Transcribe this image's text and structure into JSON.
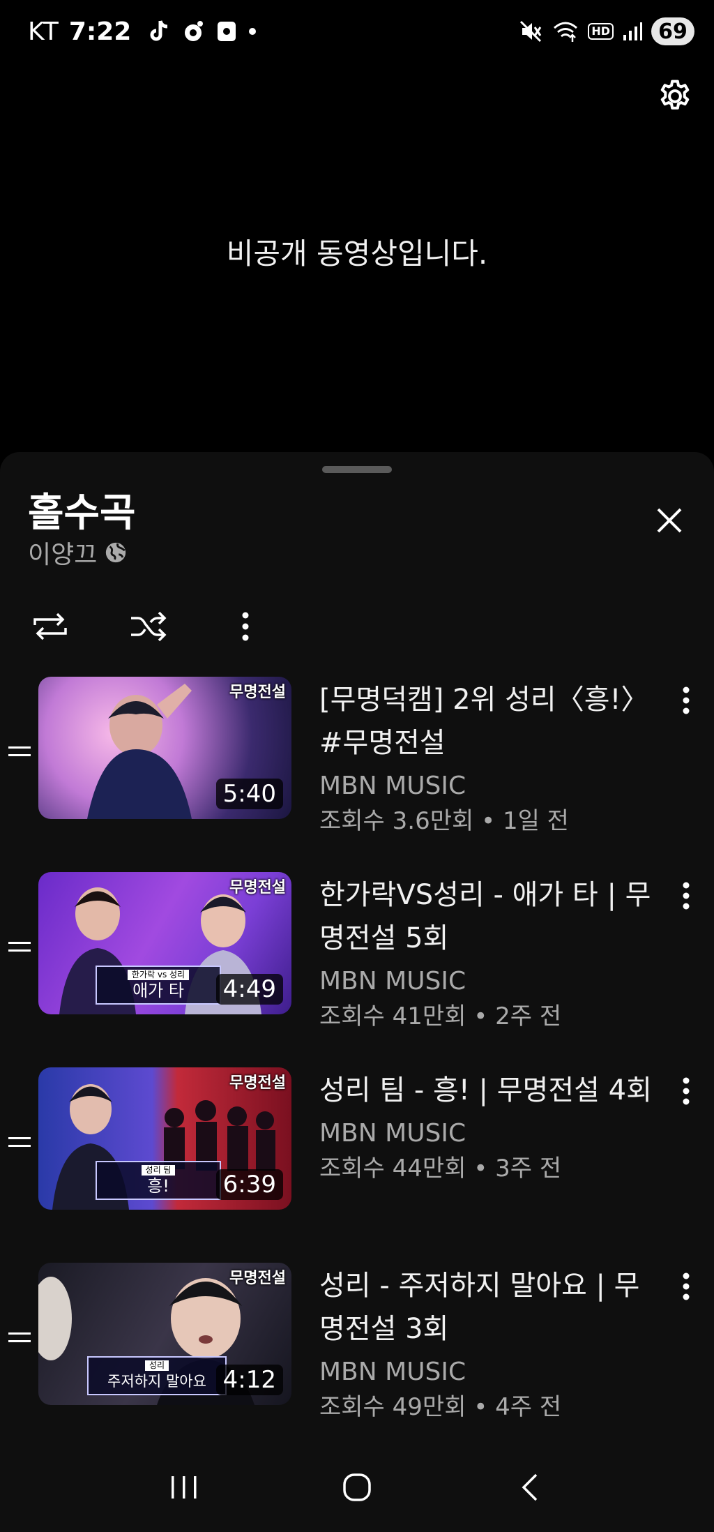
{
  "status_bar": {
    "carrier": "KT",
    "time": "7:22",
    "hd_label": "HD",
    "battery": "69",
    "icons": [
      "tiktok-icon",
      "camera-circle-icon",
      "media-box-icon",
      "dot-icon",
      "mute-icon",
      "wifi-icon",
      "signal-icon"
    ]
  },
  "player": {
    "message": "비공개 동영상입니다.",
    "settings_icon": "gear-icon"
  },
  "playlist": {
    "title": "홀수곡",
    "owner": "이양끄",
    "visibility_icon": "globe-icon",
    "controls": {
      "loop_icon": "loop-icon",
      "shuffle_icon": "shuffle-icon",
      "more_icon": "more-vertical-icon"
    },
    "items": [
      {
        "title": "[무명덕캠] 2위 성리〈흥!〉 #무명전설",
        "channel": "MBN MUSIC",
        "meta": "조회수 3.6만회 • 1일 전",
        "duration": "5:40",
        "thumb_logo": "무명전설",
        "caption_small": "",
        "caption_main": ""
      },
      {
        "title": "한가락VS성리 - 애가 타 | 무명전설 5회",
        "channel": "MBN MUSIC",
        "meta": "조회수 41만회 • 2주 전",
        "duration": "4:49",
        "thumb_logo": "무명전설",
        "caption_small": "한가락 vs 성리",
        "caption_main": "애가 타"
      },
      {
        "title": "성리 팀 - 흥! | 무명전설 4회",
        "channel": "MBN MUSIC",
        "meta": "조회수 44만회 • 3주 전",
        "duration": "6:39",
        "thumb_logo": "무명전설",
        "caption_small": "성리 팀",
        "caption_main": "흥!"
      },
      {
        "title": "성리  - 주저하지 말아요 | 무명전설 3회",
        "channel": "MBN MUSIC",
        "meta": "조회수 49만회 • 4주 전",
        "duration": "4:12",
        "thumb_logo": "무명전설",
        "caption_small": "성리",
        "caption_main": "주저하지 말아요"
      }
    ]
  },
  "nav_bar": {
    "recents_icon": "recents-icon",
    "home_icon": "home-icon",
    "back_icon": "back-icon"
  }
}
